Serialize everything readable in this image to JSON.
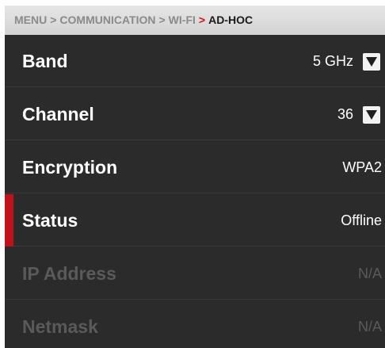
{
  "breadcrumb": {
    "items": [
      "MENU",
      "COMMUNICATION",
      "WI-FI"
    ],
    "separator": ">",
    "current": "AD-HOC"
  },
  "settings": [
    {
      "label": "Band",
      "value": "5 GHz",
      "dropdown": true,
      "state": "normal"
    },
    {
      "label": "Channel",
      "value": "36",
      "dropdown": true,
      "state": "normal"
    },
    {
      "label": "Encryption",
      "value": "WPA2",
      "dropdown": false,
      "state": "normal"
    },
    {
      "label": "Status",
      "value": "Offline",
      "dropdown": false,
      "state": "selected"
    },
    {
      "label": "IP Address",
      "value": "N/A",
      "dropdown": false,
      "state": "disabled"
    },
    {
      "label": "Netmask",
      "value": "N/A",
      "dropdown": false,
      "state": "disabled"
    }
  ],
  "colors": {
    "background": "#2b2b2b",
    "breadcrumb_bg": "#dcdcdc",
    "accent": "#c1121c",
    "text": "#ffffff",
    "disabled_text": "#5a5a5a"
  },
  "icons": {
    "dropdown": "chevron-down-icon"
  }
}
